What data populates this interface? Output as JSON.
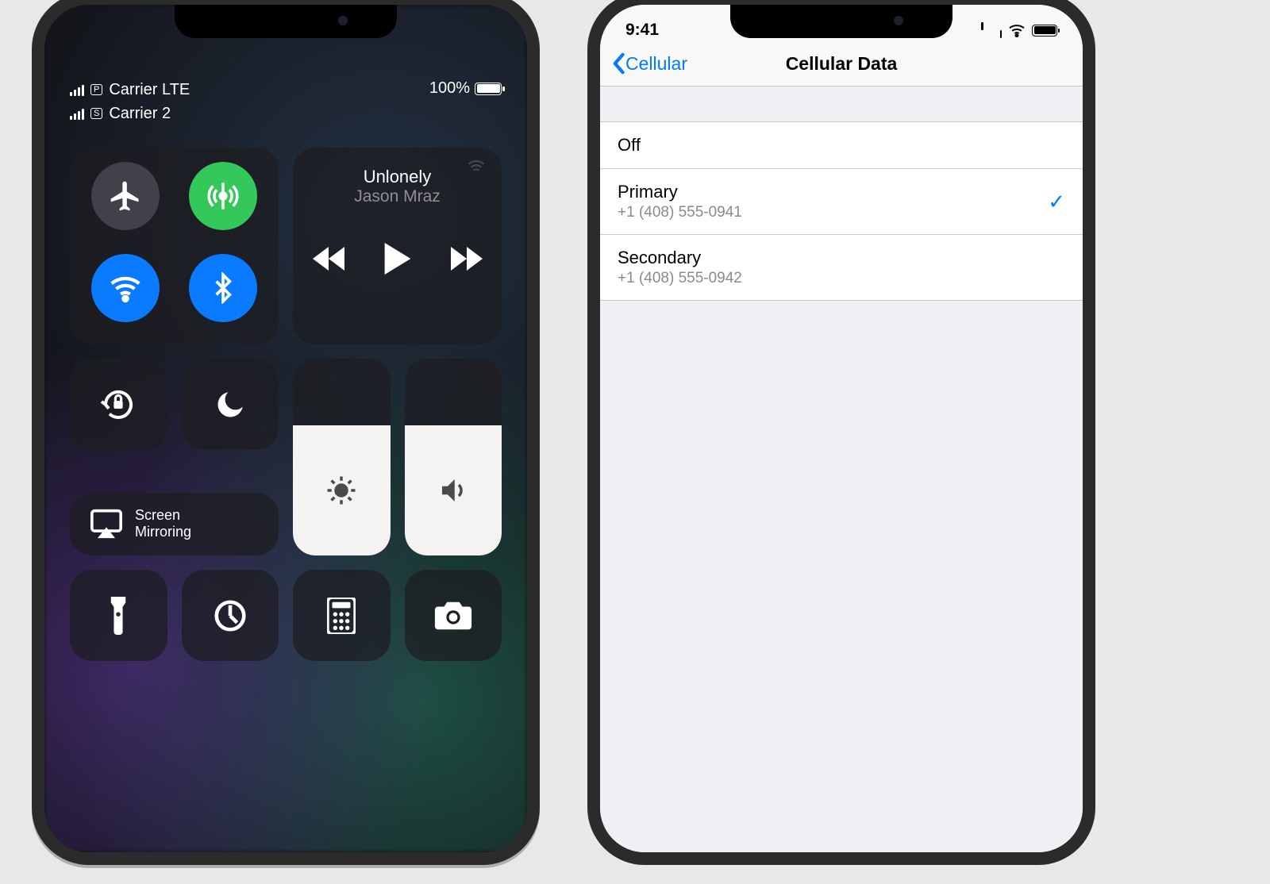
{
  "left": {
    "status": {
      "carrier1_label": "Carrier LTE",
      "carrier1_tag": "P",
      "carrier2_label": "Carrier 2",
      "carrier2_tag": "S",
      "battery_text": "100%"
    },
    "music": {
      "track": "Unlonely",
      "artist": "Jason Mraz"
    },
    "mirror_label_l1": "Screen",
    "mirror_label_l2": "Mirroring",
    "icons": {
      "airplane": "airplane-icon",
      "cellular": "cellular-icon",
      "wifi": "wifi-icon",
      "bluetooth": "bluetooth-icon",
      "orientation_lock": "orientation-lock-icon",
      "dnd": "moon-icon",
      "brightness": "brightness-icon",
      "volume": "volume-icon",
      "mirror": "airplay-icon",
      "flashlight": "flashlight-icon",
      "timer": "timer-icon",
      "calculator": "calculator-icon",
      "camera": "camera-icon"
    }
  },
  "right": {
    "status_time": "9:41",
    "nav_back": "Cellular",
    "nav_title": "Cellular Data",
    "rows": {
      "off": "Off",
      "primary": "Primary",
      "primary_number": "+1 (408) 555-0941",
      "secondary": "Secondary",
      "secondary_number": "+1 (408) 555-0942"
    }
  }
}
